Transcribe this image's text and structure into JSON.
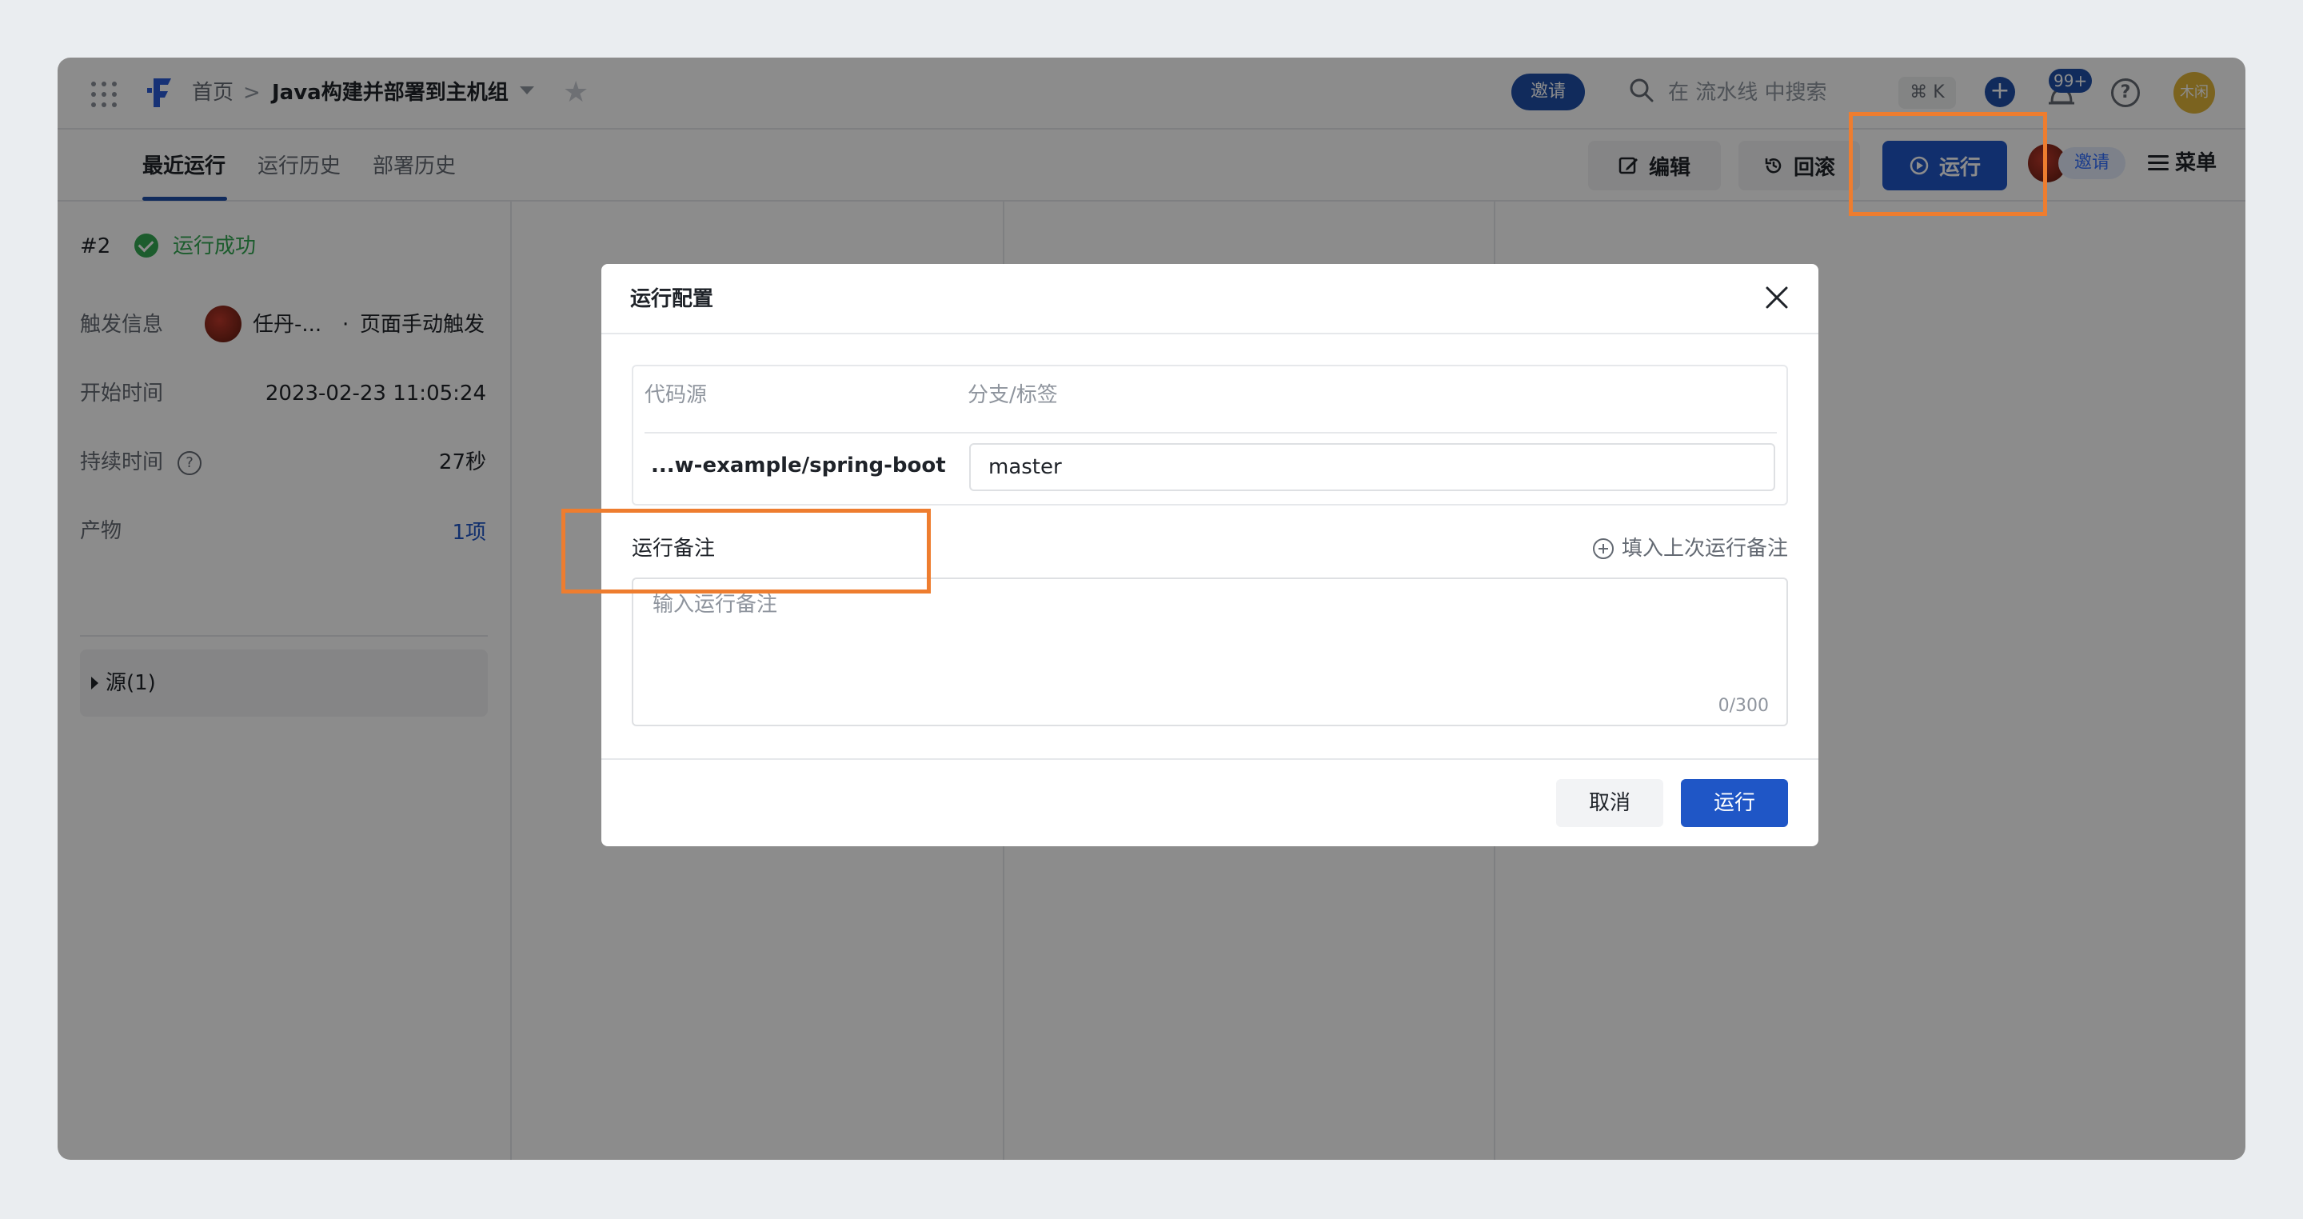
{
  "header": {
    "breadcrumb_home": "首页",
    "breadcrumb_sep": ">",
    "pipeline_title": "Java构建并部署到主机组",
    "invite_label": "邀请",
    "search_placeholder": "在 流水线 中搜索",
    "shortcut": "⌘ K",
    "plus": "+",
    "notification_badge": "99+",
    "help": "?",
    "user_avatar_text": "木闲"
  },
  "tabs": [
    {
      "label": "最近运行",
      "active": true
    },
    {
      "label": "运行历史",
      "active": false
    },
    {
      "label": "部署历史",
      "active": false
    }
  ],
  "toolbar": {
    "edit_label": "编辑",
    "rollback_label": "回滚",
    "run_label": "运行",
    "member_invite_label": "邀请",
    "menu_label": "菜单"
  },
  "run_info": {
    "run_number": "#2",
    "status": "运行成功",
    "trigger_label": "触发信息",
    "trigger_user": "任丹-...",
    "trigger_sep": "·",
    "trigger_type": "页面手动触发",
    "start_label": "开始时间",
    "start_time": "2023-02-23 11:05:24",
    "duration_label": "持续时间",
    "duration": "27秒",
    "artifact_label": "产物",
    "artifact_value": "1项",
    "sources_label": "源(1)"
  },
  "modal": {
    "title": "运行配置",
    "col_source": "代码源",
    "col_branch": "分支/标签",
    "repo": "...w-example/spring-boot",
    "branch_value": "master",
    "note_label": "运行备注",
    "fill_last_label": "填入上次运行备注",
    "note_placeholder": "输入运行备注",
    "note_count": "0/300",
    "cancel_label": "取消",
    "run_label": "运行"
  },
  "colors": {
    "primary": "#1f56c6",
    "success": "#34a853",
    "highlight": "#ee7d2f"
  }
}
